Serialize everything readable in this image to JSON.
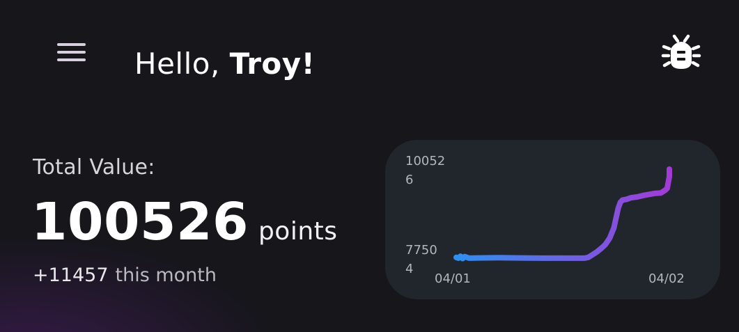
{
  "header": {
    "greeting_prefix": "Hello, ",
    "user_name": "Troy!",
    "menu_icon": "hamburger-menu-icon",
    "debug_icon": "bug-icon"
  },
  "summary": {
    "total_label": "Total Value:",
    "total_value": "100526",
    "total_unit": "points",
    "month_delta": "+11457",
    "month_label": "this month"
  },
  "colors": {
    "background": "#16161b",
    "card": "#21252c",
    "line_start": "#2f8ff0",
    "line_end": "#a23bd6"
  },
  "chart_data": {
    "type": "line",
    "y_tick_labels": [
      {
        "line1": "10052",
        "line2": "6"
      },
      {
        "line1": "7750",
        "line2": "4"
      }
    ],
    "x_tick_labels": [
      "04/01",
      "04/02"
    ],
    "ylim": [
      77504,
      100526
    ],
    "xlim": [
      0,
      1
    ],
    "series": [
      {
        "x": [
          0,
          0.01,
          0.02,
          0.03,
          0.04,
          0.06,
          0.1,
          0.2,
          0.3,
          0.4,
          0.5,
          0.6,
          0.62,
          0.64,
          0.66,
          0.68,
          0.7,
          0.72,
          0.74,
          0.75,
          0.76,
          0.77,
          0.78,
          0.8,
          0.82,
          0.85,
          0.88,
          0.9,
          0.93,
          0.96,
          0.98,
          0.99,
          1.0,
          1.0
        ],
        "y": [
          77900,
          77700,
          78200,
          77600,
          78100,
          77700,
          77750,
          77800,
          77750,
          77700,
          77700,
          77700,
          77900,
          78600,
          79300,
          80200,
          81200,
          82800,
          85500,
          88000,
          90500,
          92000,
          92600,
          92800,
          93200,
          93400,
          93800,
          94000,
          94300,
          94400,
          95100,
          95600,
          98600,
          100526
        ]
      }
    ]
  }
}
